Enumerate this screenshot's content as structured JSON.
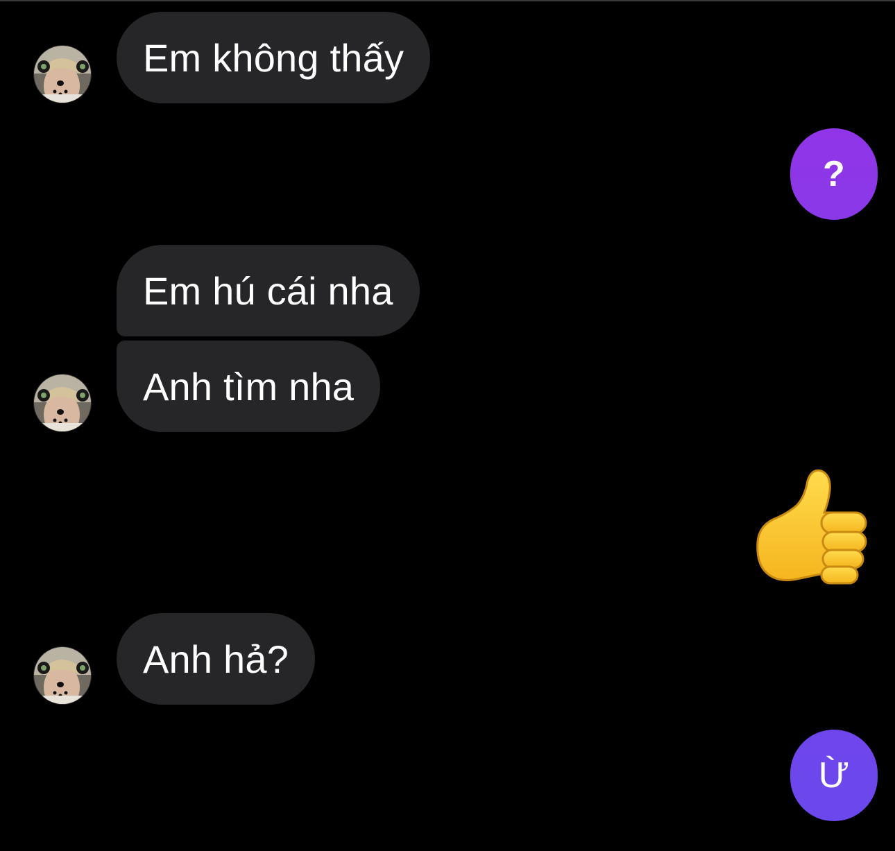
{
  "messages": [
    {
      "sender": "other",
      "text": "Em không thấy"
    },
    {
      "sender": "me",
      "text": "?"
    },
    {
      "sender": "other",
      "text": "Em hú cái nha"
    },
    {
      "sender": "other",
      "text": "Anh tìm nha"
    },
    {
      "sender": "me",
      "emoji": "thumbs-up"
    },
    {
      "sender": "other",
      "text": "Anh hả?"
    },
    {
      "sender": "me",
      "text": "Ừ"
    }
  ],
  "colors": {
    "background": "#000000",
    "incoming_bubble": "#262628",
    "outgoing_bubble_top": "#9035e8",
    "outgoing_bubble_bottom": "#6a48ec",
    "text": "#ffffff"
  }
}
